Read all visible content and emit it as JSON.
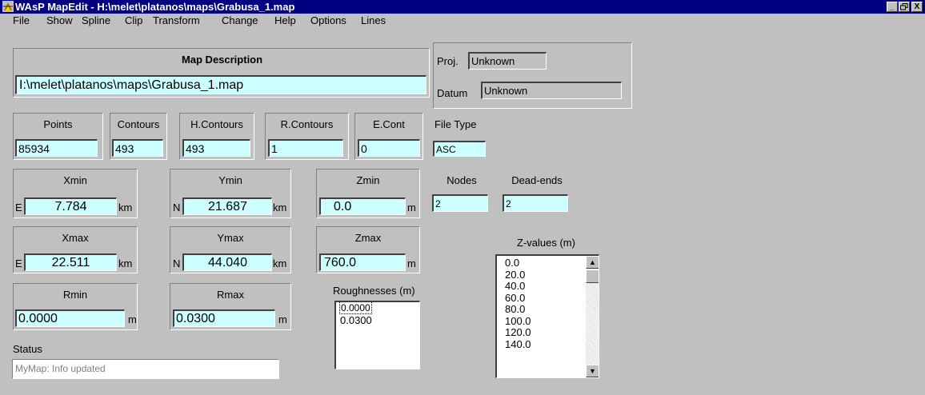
{
  "window": {
    "title": "WAsP MapEdit - H:\\melet\\platanos\\maps\\Grabusa_1.map",
    "controls": {
      "minimize": "_",
      "maximize": " ",
      "close": "X"
    }
  },
  "menu": [
    "File",
    "Show",
    "Spline",
    "Clip",
    "Transform",
    "Change",
    "Help",
    "Options",
    "Lines"
  ],
  "map_description": {
    "label": "Map Description",
    "value": "I:\\melet\\platanos\\maps\\Grabusa_1.map"
  },
  "projection": {
    "proj_label": "Proj.",
    "proj_value": "Unknown",
    "datum_label": "Datum",
    "datum_value": "Unknown"
  },
  "counts": {
    "points": {
      "label": "Points",
      "value": "85934"
    },
    "contours": {
      "label": "Contours",
      "value": "493"
    },
    "hcontours": {
      "label": "H.Contours",
      "value": "493"
    },
    "rcontours": {
      "label": "R.Contours",
      "value": "1"
    },
    "econt": {
      "label": "E.Cont",
      "value": "0"
    },
    "filetype": {
      "label": "File Type",
      "value": "ASC"
    }
  },
  "extents": {
    "xmin": {
      "label": "Xmin",
      "prefix": "E",
      "value": "7.784",
      "unit": "km"
    },
    "ymin": {
      "label": "Ymin",
      "prefix": "N",
      "value": "21.687",
      "unit": "km"
    },
    "zmin": {
      "label": "Zmin",
      "value": "0.0",
      "unit": "m"
    },
    "xmax": {
      "label": "Xmax",
      "prefix": "E",
      "value": "22.511",
      "unit": "km"
    },
    "ymax": {
      "label": "Ymax",
      "prefix": "N",
      "value": "44.040",
      "unit": "km"
    },
    "zmax": {
      "label": "Zmax",
      "value": "760.0",
      "unit": "m"
    },
    "rmin": {
      "label": "Rmin",
      "value": "0.0000",
      "unit": "m"
    },
    "rmax": {
      "label": "Rmax",
      "value": "0.0300",
      "unit": "m"
    }
  },
  "nodes": {
    "label": "Nodes",
    "value": "2"
  },
  "dead_ends": {
    "label": "Dead-ends",
    "value": "2"
  },
  "roughnesses": {
    "label": "Roughnesses (m)",
    "items": [
      "0.0000",
      "0.0300"
    ]
  },
  "z_values": {
    "label": "Z-values (m)",
    "items": [
      "0.0",
      "20.0",
      "40.0",
      "60.0",
      "80.0",
      "100.0",
      "120.0",
      "140.0"
    ],
    "scroll_up": "▲",
    "scroll_down": "▼"
  },
  "status": {
    "label": "Status",
    "value": "MyMap: Info updated"
  },
  "colors": {
    "title_bar": "#000080",
    "field_bg": "#ccffff",
    "window_bg": "#c0c0c0"
  }
}
